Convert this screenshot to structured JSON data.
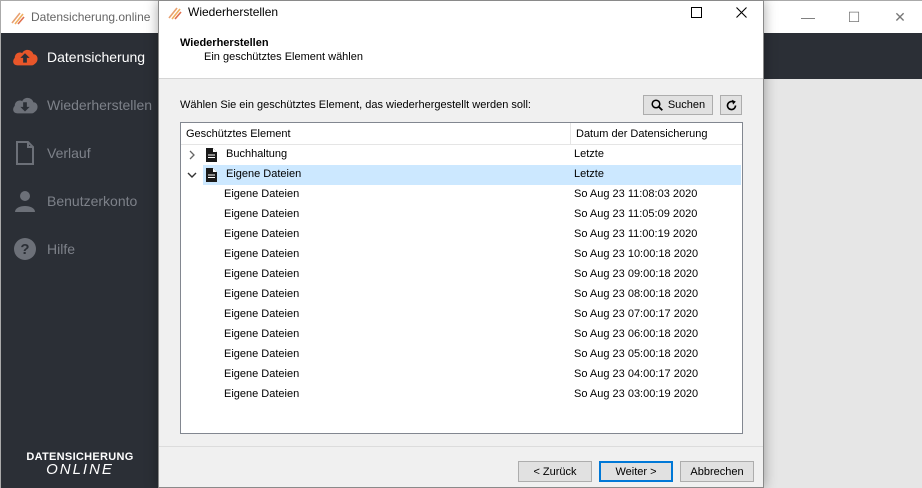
{
  "app": {
    "title": "Datensicherung.online",
    "nav": [
      {
        "label": "Datensicherung",
        "icon": "cloud-upload-icon",
        "active": true
      },
      {
        "label": "Wiederherstellen",
        "icon": "cloud-download-icon",
        "active": false
      },
      {
        "label": "Verlauf",
        "icon": "document-icon",
        "active": false
      },
      {
        "label": "Benutzerkonto",
        "icon": "user-icon",
        "active": false
      },
      {
        "label": "Hilfe",
        "icon": "help-icon",
        "active": false
      }
    ],
    "brand_line1": "DATENSICHERUNG",
    "brand_line2": "ONLINE"
  },
  "dialog": {
    "title": "Wiederherstellen",
    "heading": "Wiederherstellen",
    "subheading": "Ein geschütztes Element wählen",
    "instruction": "Wählen Sie ein geschütztes Element, das wiederhergestellt werden soll:",
    "search_label": "Suchen",
    "columns": {
      "element": "Geschütztes Element",
      "date": "Datum der Datensicherung"
    },
    "rows": [
      {
        "name": "Buchhaltung",
        "date": "Letzte",
        "level": 0,
        "expander": "collapsed",
        "selected": false
      },
      {
        "name": "Eigene Dateien",
        "date": "Letzte",
        "level": 0,
        "expander": "expanded",
        "selected": true
      },
      {
        "name": "Eigene Dateien",
        "date": "So Aug 23 11:08:03 2020",
        "level": 1
      },
      {
        "name": "Eigene Dateien",
        "date": "So Aug 23 11:05:09 2020",
        "level": 1
      },
      {
        "name": "Eigene Dateien",
        "date": "So Aug 23 11:00:19 2020",
        "level": 1
      },
      {
        "name": "Eigene Dateien",
        "date": "So Aug 23 10:00:18 2020",
        "level": 1
      },
      {
        "name": "Eigene Dateien",
        "date": "So Aug 23 09:00:18 2020",
        "level": 1
      },
      {
        "name": "Eigene Dateien",
        "date": "So Aug 23 08:00:18 2020",
        "level": 1
      },
      {
        "name": "Eigene Dateien",
        "date": "So Aug 23 07:00:17 2020",
        "level": 1
      },
      {
        "name": "Eigene Dateien",
        "date": "So Aug 23 06:00:18 2020",
        "level": 1
      },
      {
        "name": "Eigene Dateien",
        "date": "So Aug 23 05:00:18 2020",
        "level": 1
      },
      {
        "name": "Eigene Dateien",
        "date": "So Aug 23 04:00:17 2020",
        "level": 1
      },
      {
        "name": "Eigene Dateien",
        "date": "So Aug 23 03:00:19 2020",
        "level": 1
      }
    ],
    "buttons": {
      "back": "< Zurück",
      "next": "Weiter >",
      "cancel": "Abbrechen"
    }
  },
  "colors": {
    "sidebar_bg": "#2b2f36",
    "accent_orange": "#e8562a",
    "selection": "#cce8ff",
    "default_button_border": "#0078d7"
  }
}
